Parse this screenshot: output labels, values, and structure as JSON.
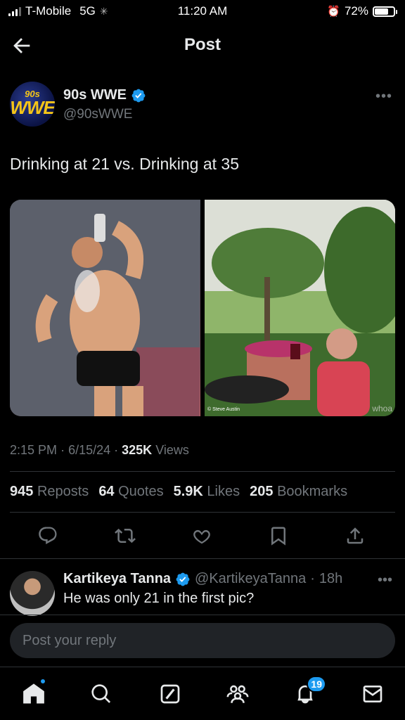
{
  "status_bar": {
    "carrier": "T-Mobile",
    "network": "5G",
    "time": "11:20 AM",
    "battery": "72%",
    "battery_level": 0.72
  },
  "header": {
    "title": "Post"
  },
  "post": {
    "author_name": "90s WWE",
    "author_handle": "@90sWWE",
    "avatar_top": "90s",
    "avatar_bottom": "WWE",
    "text": "Drinking at 21 vs. Drinking at 35",
    "time": "2:15 PM",
    "date": "6/15/24",
    "views_count": "325K",
    "views_label": "Views",
    "reposts_count": "945",
    "reposts_label": "Reposts",
    "quotes_count": "64",
    "quotes_label": "Quotes",
    "likes_count": "5.9K",
    "likes_label": "Likes",
    "bookmarks_count": "205",
    "bookmarks_label": "Bookmarks",
    "image2_caption": "© Steve Austin",
    "image2_watermark": "whoa"
  },
  "reply": {
    "name": "Kartikeya Tanna",
    "handle": "@KartikeyaTanna",
    "age": "18h",
    "text": "He was only 21 in the first pic?"
  },
  "reply_box": {
    "placeholder": "Post your reply"
  },
  "tab_bar": {
    "notifications_badge": "19"
  },
  "colors": {
    "accent": "#1d9bf0",
    "background": "#000000",
    "secondary_text": "#71767b"
  }
}
